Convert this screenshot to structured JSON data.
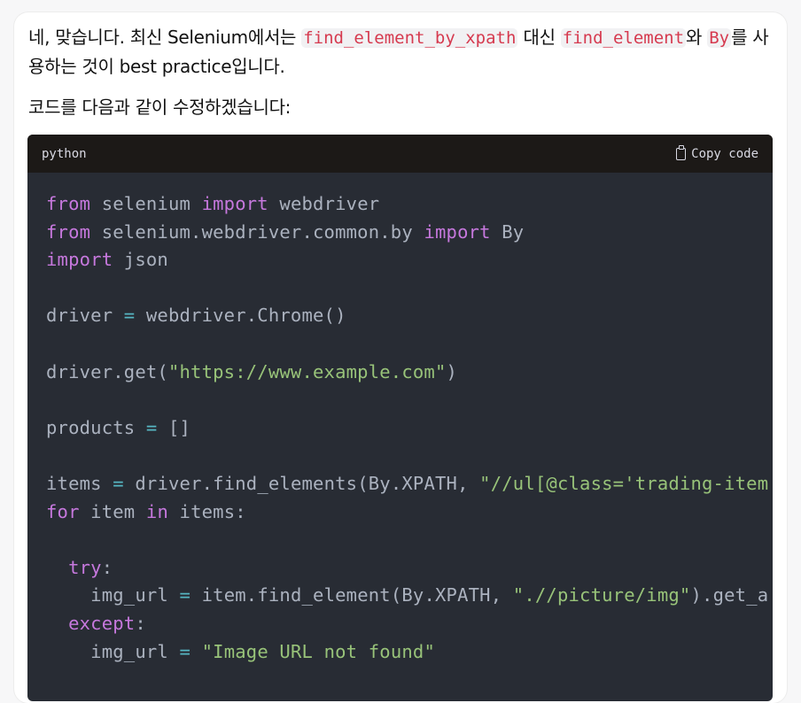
{
  "message": {
    "para1": {
      "t1": "네, 맞습니다. 최신 Selenium에서는 ",
      "c1": "find_element_by_xpath",
      "t2": " 대신 ",
      "c2": "find_element",
      "t3": "와 ",
      "c3": "By",
      "t4": "를 사용하는 것이 best practice입니다."
    },
    "para2": "코드를 다음과 같이 수정하겠습니다:"
  },
  "code_block": {
    "language": "python",
    "copy_label": "Copy code",
    "lines": [
      [
        [
          "kw",
          "from"
        ],
        [
          "txt",
          " selenium "
        ],
        [
          "kw",
          "import"
        ],
        [
          "txt",
          " webdriver"
        ]
      ],
      [
        [
          "kw",
          "from"
        ],
        [
          "txt",
          " selenium.webdriver.common.by "
        ],
        [
          "kw",
          "import"
        ],
        [
          "txt",
          " By"
        ]
      ],
      [
        [
          "kw",
          "import"
        ],
        [
          "txt",
          " json"
        ]
      ],
      [],
      [
        [
          "txt",
          "driver "
        ],
        [
          "op",
          "="
        ],
        [
          "txt",
          " webdriver.Chrome()"
        ]
      ],
      [],
      [
        [
          "txt",
          "driver.get("
        ],
        [
          "str",
          "\"https://www.example.com\""
        ],
        [
          "txt",
          ")"
        ]
      ],
      [],
      [
        [
          "txt",
          "products "
        ],
        [
          "op",
          "="
        ],
        [
          "txt",
          " []"
        ]
      ],
      [],
      [
        [
          "txt",
          "items "
        ],
        [
          "op",
          "="
        ],
        [
          "txt",
          " driver.find_elements(By.XPATH, "
        ],
        [
          "str",
          "\"//ul[@class='trading-item"
        ]
      ],
      [
        [
          "kw",
          "for"
        ],
        [
          "txt",
          " item "
        ],
        [
          "kw",
          "in"
        ],
        [
          "txt",
          " items:"
        ]
      ],
      [],
      [
        [
          "txt",
          "  "
        ],
        [
          "kw",
          "try"
        ],
        [
          "txt",
          ":"
        ]
      ],
      [
        [
          "txt",
          "    img_url "
        ],
        [
          "op",
          "="
        ],
        [
          "txt",
          " item.find_element(By.XPATH, "
        ],
        [
          "str",
          "\".//picture/img\""
        ],
        [
          "txt",
          ").get_a"
        ]
      ],
      [
        [
          "txt",
          "  "
        ],
        [
          "kw",
          "except"
        ],
        [
          "txt",
          ":"
        ]
      ],
      [
        [
          "txt",
          "    img_url "
        ],
        [
          "op",
          "="
        ],
        [
          "txt",
          " "
        ],
        [
          "str",
          "\"Image URL not found\""
        ]
      ]
    ]
  }
}
